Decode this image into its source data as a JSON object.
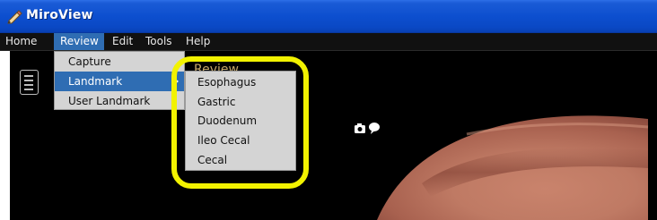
{
  "window": {
    "title": "MiroView",
    "icon": "app-pencil-icon"
  },
  "menubar": {
    "items": [
      {
        "label": "Home"
      },
      {
        "label": "Review"
      },
      {
        "label": "Edit"
      },
      {
        "label": "Tools"
      },
      {
        "label": "Help"
      }
    ]
  },
  "review_menu": {
    "items": [
      {
        "label": "Capture"
      },
      {
        "label": "Landmark"
      },
      {
        "label": "User Landmark"
      }
    ]
  },
  "landmark_submenu": {
    "items": [
      {
        "label": "Esophagus"
      },
      {
        "label": "Gastric"
      },
      {
        "label": "Duodenum"
      },
      {
        "label": "Ileo Cecal"
      },
      {
        "label": "Cecal"
      }
    ]
  },
  "content": {
    "section_label": "Review",
    "sidebar_icon": "list-icon",
    "toolbar_icons": [
      "camera-icon",
      "comment-icon"
    ]
  },
  "colors": {
    "titlebar": "#0d4fcf",
    "menubar": "#111111",
    "menu_highlight": "#2f6db3",
    "annotation": "#f2f200"
  }
}
